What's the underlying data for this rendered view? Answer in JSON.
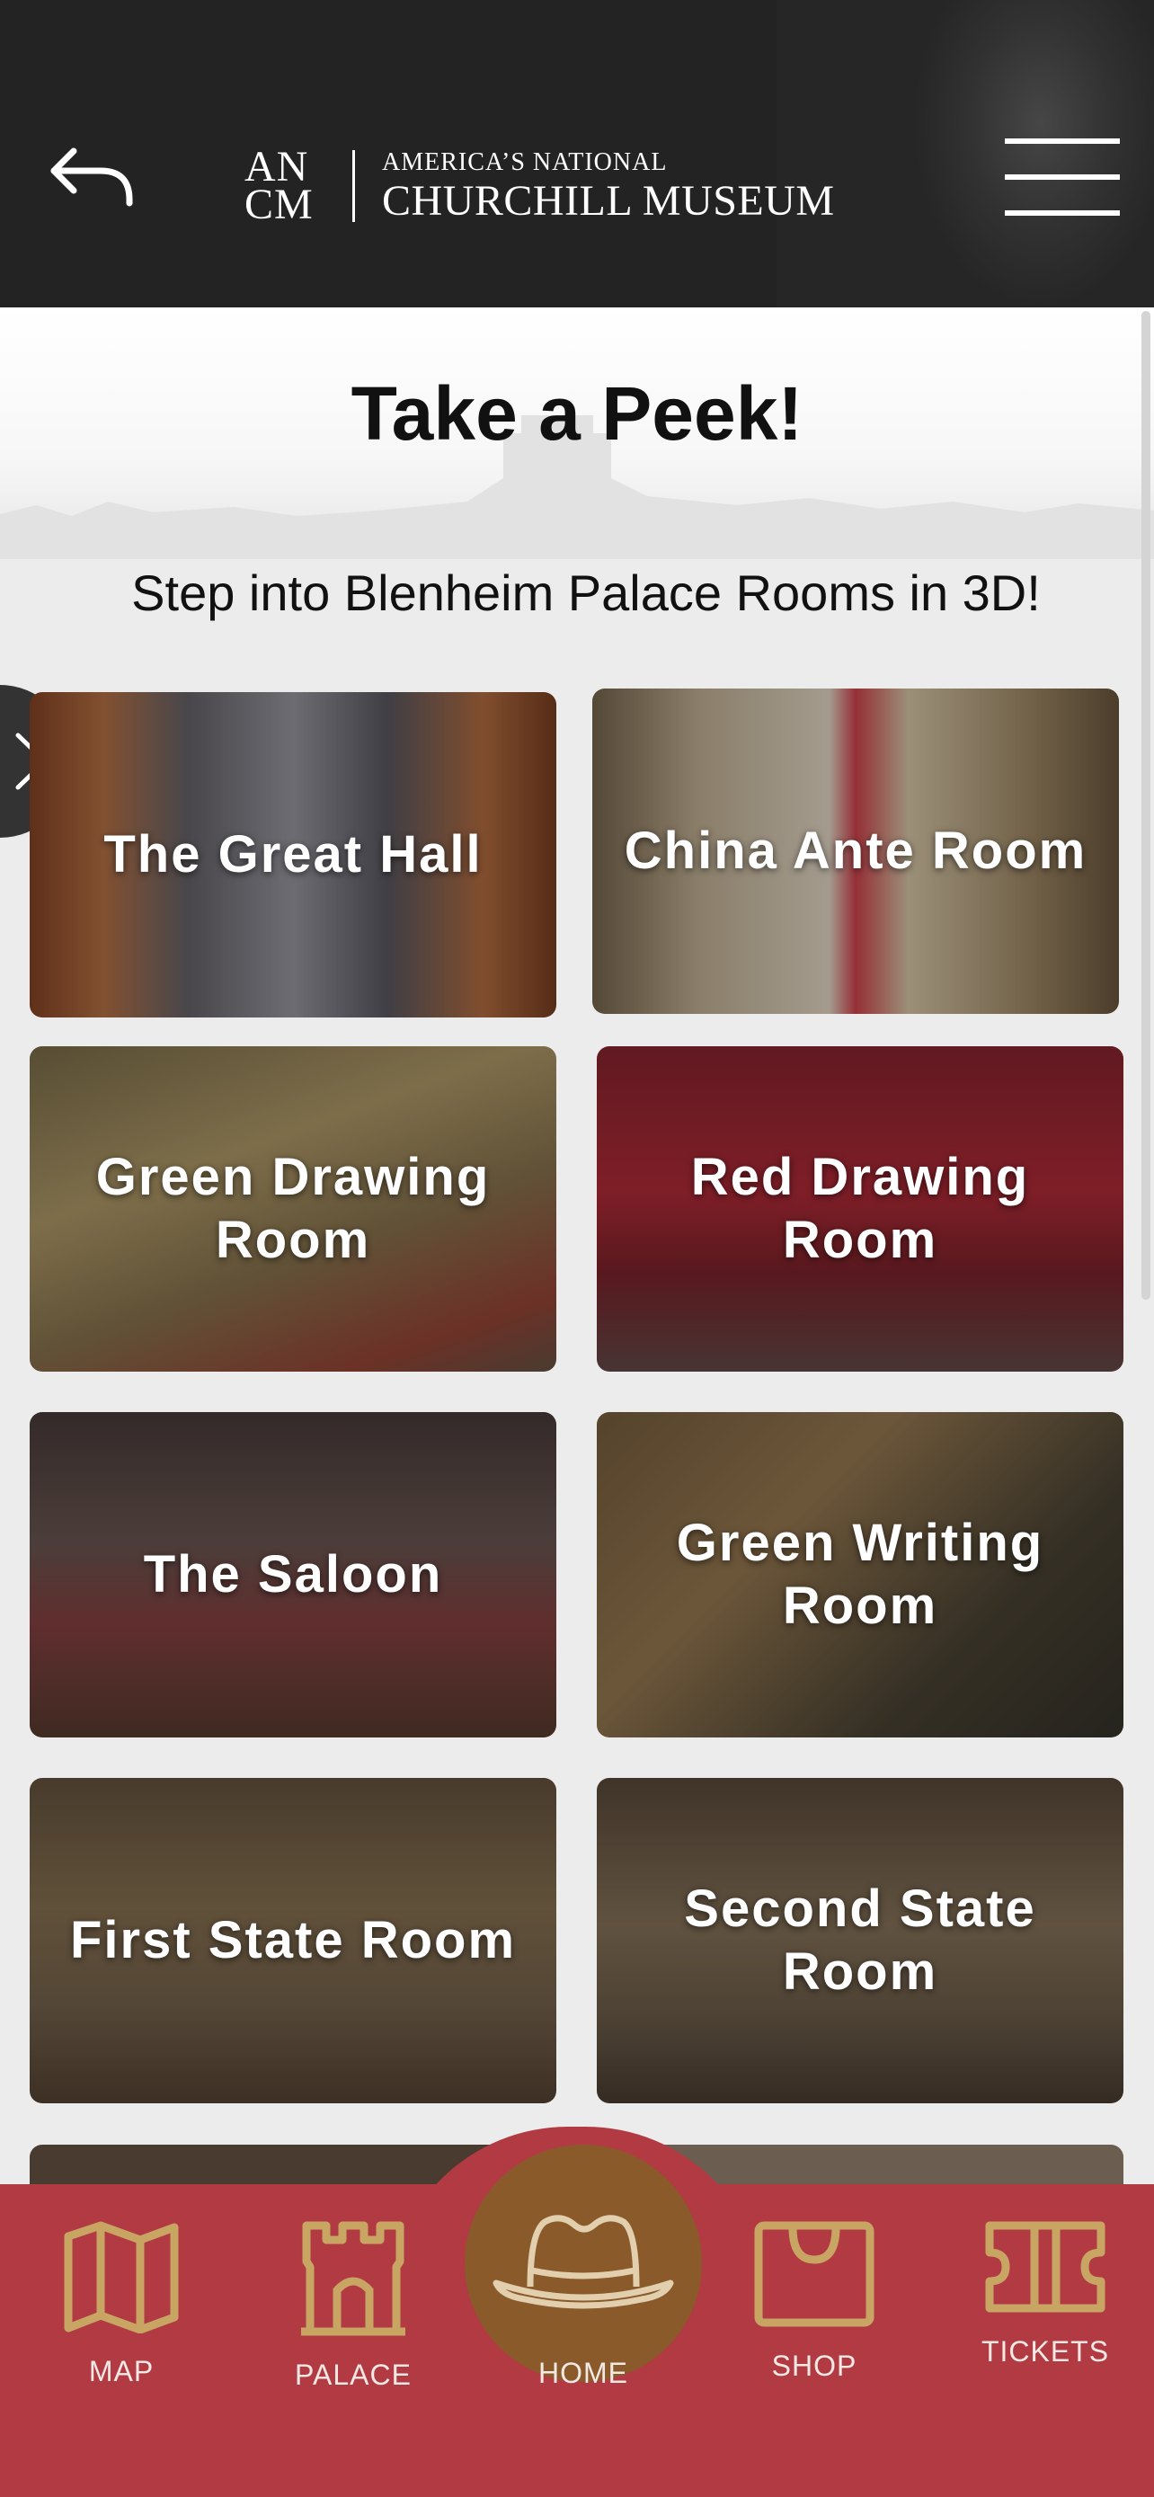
{
  "header": {
    "logo_mono_top": "AN",
    "logo_mono_bottom": "CM",
    "logo_line1": "AMERICA’S NATIONAL",
    "logo_line2": "CHURCHILL MUSEUM",
    "back_icon": "back-arrow-icon",
    "menu_icon": "hamburger-menu-icon"
  },
  "main": {
    "title": "Take a Peek!",
    "subtitle": "Step into Blenheim Palace Rooms in 3D!",
    "side_tab_icon": "chevron-right-icon"
  },
  "rooms": [
    {
      "label": "The Great Hall"
    },
    {
      "label": "China Ante Room"
    },
    {
      "label": "Green Drawing Room"
    },
    {
      "label": "Red Drawing Room"
    },
    {
      "label": "The Saloon"
    },
    {
      "label": "Green Writing Room"
    },
    {
      "label": "First State Room"
    },
    {
      "label": "Second State Room"
    }
  ],
  "nav": {
    "map": {
      "label": "MAP",
      "icon": "map-icon"
    },
    "palace": {
      "label": "PALACE",
      "icon": "castle-tower-icon"
    },
    "home": {
      "label": "HOME",
      "icon": "fedora-hat-icon"
    },
    "shop": {
      "label": "SHOP",
      "icon": "shopping-bag-icon"
    },
    "tickets": {
      "label": "TICKETS",
      "icon": "ticket-icon"
    }
  },
  "colors": {
    "header_bg": "#232323",
    "nav_bg": "#b23a43",
    "accent_gold": "#c9a563",
    "home_circle": "#8b5a2b"
  }
}
